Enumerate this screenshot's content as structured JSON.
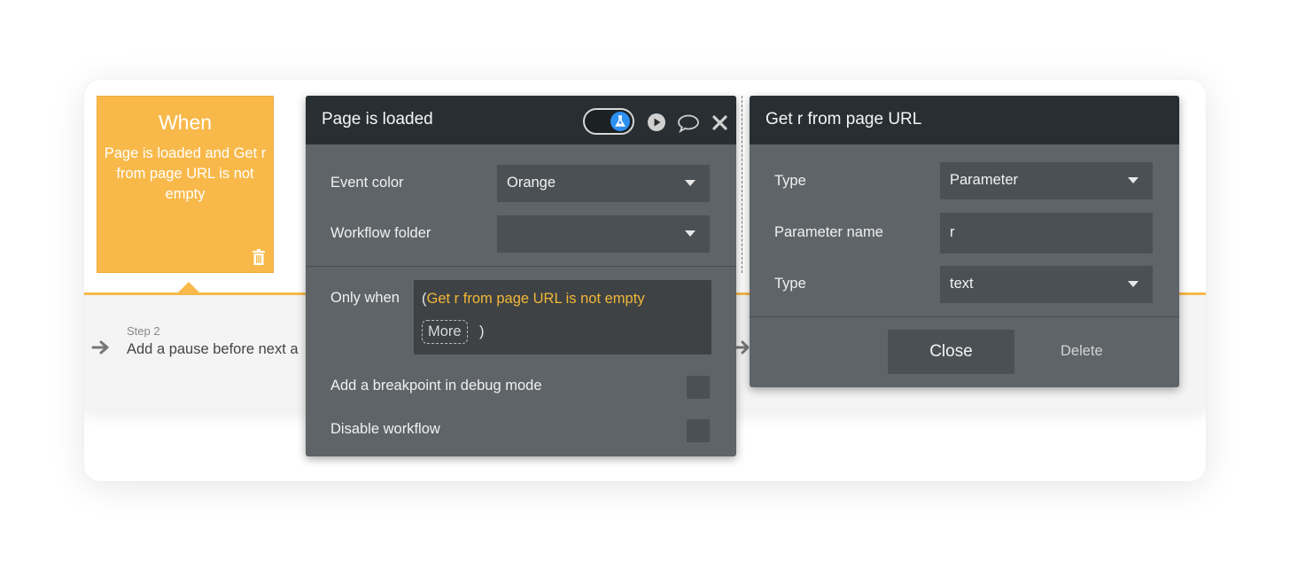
{
  "event_card": {
    "title": "When",
    "description": "Page is loaded and Get r from page URL is not empty"
  },
  "step": {
    "label": "Step 2",
    "title": "Add a pause before next a"
  },
  "event_panel": {
    "title": "Page is loaded",
    "event_color_label": "Event color",
    "event_color_value": "Orange",
    "workflow_folder_label": "Workflow folder",
    "workflow_folder_value": "",
    "only_when_label": "Only when",
    "condition_open_paren": "(",
    "condition_text": "Get r from page URL is not empty",
    "more_label": "More",
    "condition_close_paren": ")",
    "breakpoint_label": "Add a breakpoint in debug mode",
    "disable_label": "Disable workflow"
  },
  "url_panel": {
    "title": "Get r from page URL",
    "type_label": "Type",
    "type_value": "Parameter",
    "param_name_label": "Parameter name",
    "param_name_value": "r",
    "type2_label": "Type",
    "type2_value": "text",
    "close_label": "Close",
    "delete_label": "Delete"
  },
  "colors": {
    "accent_orange": "#f8b94a",
    "panel_bg": "#5f6468",
    "panel_header": "#282e31",
    "condition_text": "#f2b736",
    "toggle_blue": "#2d8ff0"
  },
  "icons": [
    "trash-icon",
    "flask-icon",
    "play-icon",
    "comment-icon",
    "close-icon",
    "arrow-right-icon",
    "dropdown-caret-icon"
  ]
}
